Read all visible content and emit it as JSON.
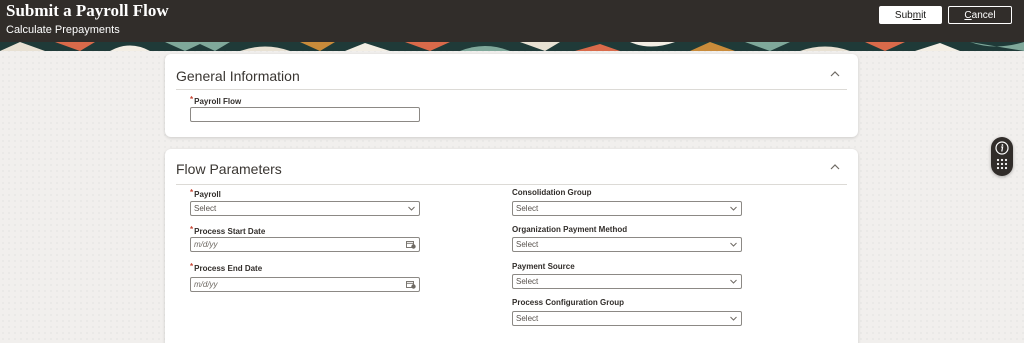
{
  "header": {
    "title": "Submit a Payroll Flow",
    "subtitle": "Calculate Prepayments",
    "submit_label": "Submit",
    "submit_mnemonic": "m",
    "cancel_label": "Cancel",
    "cancel_mnemonic": "C"
  },
  "general_information": {
    "title": "General Information",
    "payroll_flow_label": "Payroll Flow",
    "payroll_flow_value": "",
    "required_mark": "*"
  },
  "flow_parameters": {
    "title": "Flow Parameters",
    "required_mark": "*",
    "payroll_label": "Payroll",
    "payroll_value": "Select",
    "process_start_date_label": "Process Start Date",
    "process_start_date_placeholder": "m/d/yy",
    "process_end_date_label": "Process End Date",
    "process_end_date_placeholder": "m/d/yy",
    "consolidation_group_label": "Consolidation Group",
    "consolidation_group_value": "Select",
    "organization_payment_method_label": "Organization Payment Method",
    "organization_payment_method_value": "Select",
    "payment_source_label": "Payment Source",
    "payment_source_value": "Select",
    "process_configuration_group_label": "Process Configuration Group",
    "process_configuration_group_value": "Select"
  },
  "icons": {
    "collapse": "chevron-up-icon",
    "select": "chevron-down-icon",
    "date": "calendar-icon",
    "info": "info-icon",
    "apps": "grid-icon"
  },
  "colors": {
    "header_bg": "#312d2a",
    "required": "#c74634",
    "page_bg": "#f1efed"
  }
}
